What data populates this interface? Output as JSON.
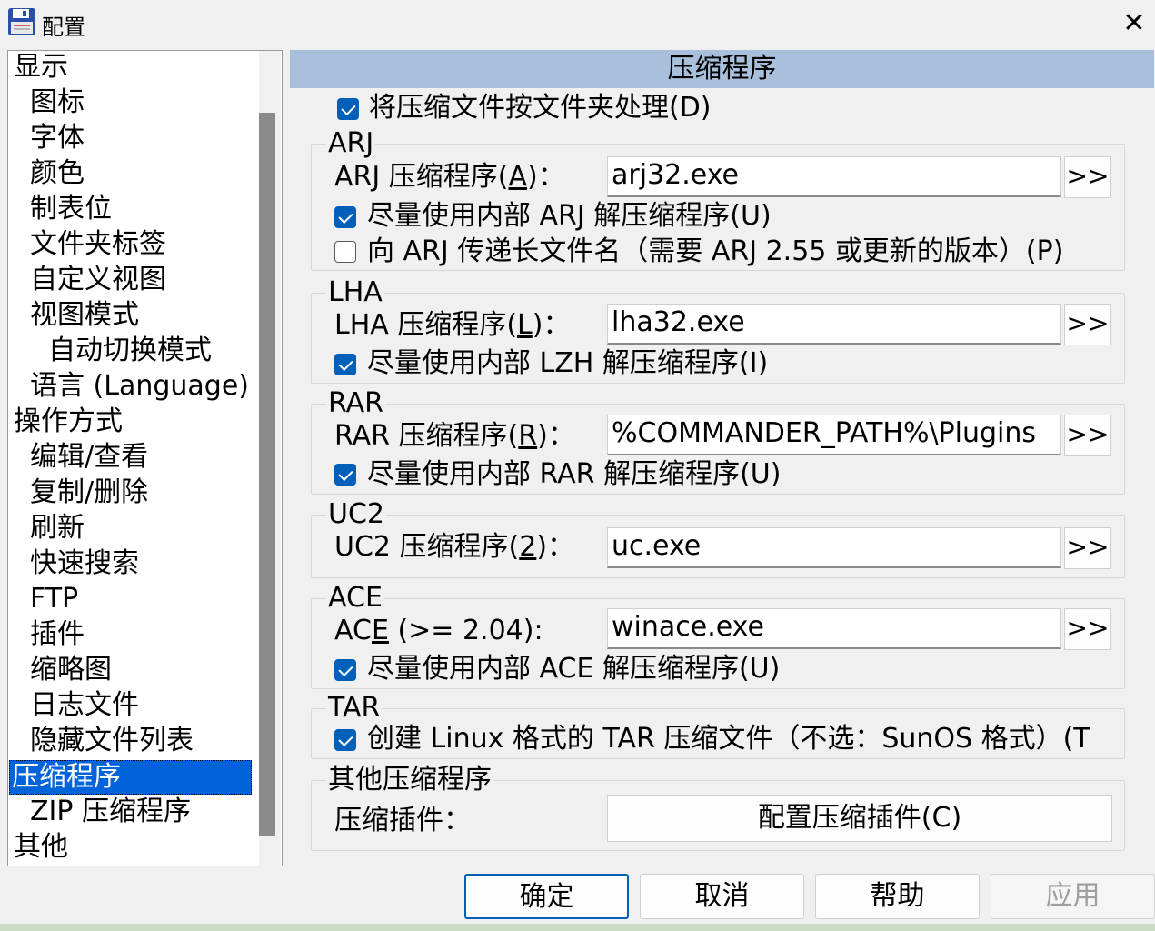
{
  "window": {
    "title": "配置",
    "close_glyph": "✕"
  },
  "tree": {
    "items": [
      {
        "label": "显示",
        "level": 0
      },
      {
        "label": "图标",
        "level": 1
      },
      {
        "label": "字体",
        "level": 1
      },
      {
        "label": "颜色",
        "level": 1
      },
      {
        "label": "制表位",
        "level": 1
      },
      {
        "label": "文件夹标签",
        "level": 1
      },
      {
        "label": "自定义视图",
        "level": 1
      },
      {
        "label": "视图模式",
        "level": 1
      },
      {
        "label": "自动切换模式",
        "level": 2
      },
      {
        "label": "语言 (Language)",
        "level": 1
      },
      {
        "label": "操作方式",
        "level": 0
      },
      {
        "label": "编辑/查看",
        "level": 1
      },
      {
        "label": "复制/删除",
        "level": 1
      },
      {
        "label": "刷新",
        "level": 1
      },
      {
        "label": "快速搜索",
        "level": 1
      },
      {
        "label": "FTP",
        "level": 1
      },
      {
        "label": "插件",
        "level": 1
      },
      {
        "label": "缩略图",
        "level": 1
      },
      {
        "label": "日志文件",
        "level": 1
      },
      {
        "label": "隐藏文件列表",
        "level": 1
      },
      {
        "label": "压缩程序",
        "level": 0,
        "selected": true
      },
      {
        "label": "ZIP 压缩程序",
        "level": 1
      },
      {
        "label": "其他",
        "level": 0
      }
    ]
  },
  "panel": {
    "title": "压缩程序",
    "top_checkbox": {
      "label": "将压缩文件按文件夹处理(D)",
      "checked": true
    },
    "browse_label": ">>",
    "arj": {
      "group": "ARJ",
      "packer_label_pre": "ARJ 压缩程序(",
      "packer_label_key": "A",
      "packer_label_post": ")：",
      "packer_value": "arj32.exe",
      "internal": {
        "label": "尽量使用内部 ARJ 解压缩程序(U)",
        "checked": true
      },
      "longnames": {
        "label": "向 ARJ 传递长文件名（需要 ARJ 2.55 或更新的版本）(P)",
        "checked": false
      }
    },
    "lha": {
      "group": "LHA",
      "packer_label_pre": "LHA 压缩程序(",
      "packer_label_key": "L",
      "packer_label_post": ")：",
      "packer_value": "lha32.exe",
      "internal": {
        "label": "尽量使用内部 LZH 解压缩程序(I)",
        "checked": true
      }
    },
    "rar": {
      "group": "RAR",
      "packer_label_pre": "RAR 压缩程序(",
      "packer_label_key": "R",
      "packer_label_post": ")：",
      "packer_value": "%COMMANDER_PATH%\\Plugins",
      "internal": {
        "label": "尽量使用内部 RAR 解压缩程序(U)",
        "checked": true
      }
    },
    "uc2": {
      "group": "UC2",
      "packer_label_pre": "UC2 压缩程序(",
      "packer_label_key": "2",
      "packer_label_post": ")：",
      "packer_value": "uc.exe"
    },
    "ace": {
      "group": "ACE",
      "packer_label_pre": "AC",
      "packer_label_key": "E",
      "packer_label_post": " (>= 2.04):",
      "packer_value": "winace.exe",
      "internal": {
        "label": "尽量使用内部 ACE 解压缩程序(U)",
        "checked": true
      }
    },
    "tar": {
      "group": "TAR",
      "linux": {
        "label": "创建 Linux 格式的 TAR 压缩文件（不选：SunOS 格式）(T",
        "checked": true
      }
    },
    "other": {
      "group": "其他压缩程序",
      "plugins_label": "压缩插件：",
      "configure_button": "配置压缩插件(C)"
    }
  },
  "buttons": {
    "ok": "确定",
    "cancel": "取消",
    "help": "帮助",
    "apply": "应用"
  },
  "colors": {
    "selection": "#0063d9",
    "header_bg": "#a8c0dc",
    "checkbox": "#005fb8"
  }
}
